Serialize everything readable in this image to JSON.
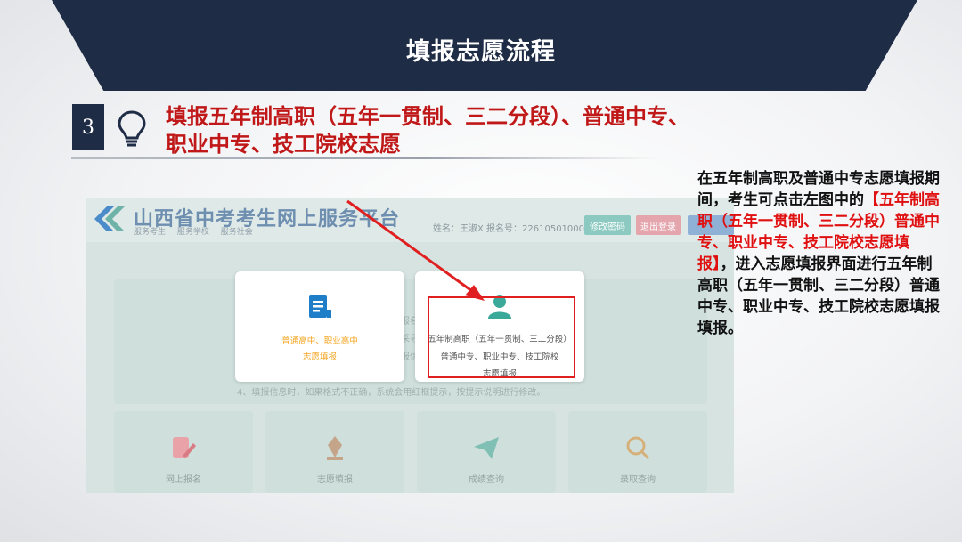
{
  "header": {
    "title": "填报志愿流程"
  },
  "step": {
    "number": "3",
    "title_line1": "填报五年制高职（五年一贯制、三二分段）、普通中专、",
    "title_line2": "职业中专、技工院校志愿"
  },
  "screenshot": {
    "site_title": "山西省中考考生网上服务平台",
    "nav": [
      "服务考生",
      "服务学校",
      "服务社会"
    ],
    "user_info": "姓名：王淑X  报名号：226105010001",
    "buttons": {
      "change_password": "修改密码",
      "logout": "退出登录",
      "extra": ""
    },
    "notice_partial": [
      "报名",
      "采寻",
      "报信"
    ],
    "notice_line4": "4、填报信息时，如果格式不正确，系统会用红框提示，按提示说明进行修改。",
    "card_left": {
      "line1": "普通高中、职业高中",
      "line2": "志愿填报"
    },
    "card_right": {
      "line1": "五年制高职（五年一贯制、三二分段）",
      "line2": "普通中专、职业中专、技工院校",
      "line3": "志愿填报"
    },
    "tiles": [
      "网上报名",
      "志愿填报",
      "成绩查询",
      "录取查询"
    ],
    "colors": {
      "orange": "#f5a623",
      "teal": "#3aa99a",
      "blue": "#1e7fc8",
      "red_box": "#e02020"
    }
  },
  "explain": {
    "before": "在五年制高职及普通中专志愿填报期间，考生可点击左图中的",
    "highlight": "【五年制高职（五年一贯制、三二分段）普通中专、职业中专、技工院校志愿填报】",
    "after": "，进入志愿填报界面进行五年制高职（五年一贯制、三二分段）普通中专、职业中专、技工院校志愿填报填报。"
  },
  "icons": [
    "lightbulb-icon",
    "logo-icon",
    "document-icon",
    "user-icon",
    "edit-icon",
    "pen-icon",
    "paper-plane-icon",
    "search-icon"
  ]
}
